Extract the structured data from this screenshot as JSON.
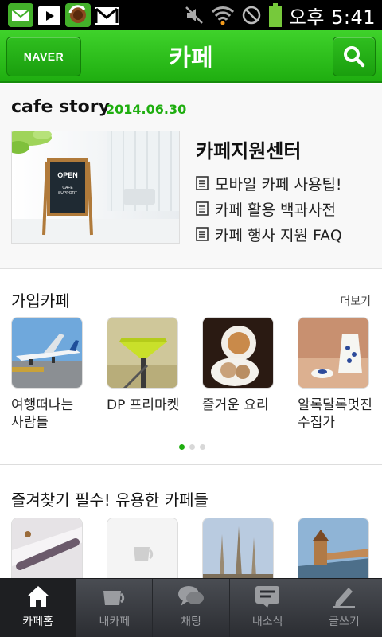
{
  "status_bar": {
    "time": "오후 5:41",
    "icons": [
      "mail-icon",
      "play-store-icon",
      "cafe-app-icon",
      "gmail-icon",
      "mute-icon",
      "wifi-icon",
      "no-signal-icon",
      "battery-icon"
    ]
  },
  "header": {
    "naver_label": "NAVER",
    "title": "카페"
  },
  "story": {
    "title": "cafe story",
    "date": "2014.06.30",
    "sign_line1": "OPEN",
    "sign_line2": "CAFE",
    "sign_line3": "SUPPORT",
    "heading": "카페지원센터",
    "links": [
      "모바일 카페 사용팁!",
      "카페 활용 백과사전",
      "카페 행사 지원 FAQ"
    ]
  },
  "joined": {
    "title": "가입카페",
    "more": "더보기",
    "cafes": [
      {
        "name": "여행떠나는\n사람들"
      },
      {
        "name": "DP 프리마켓"
      },
      {
        "name": "즐거운 요리"
      },
      {
        "name": "알록달록멋진\n수집가"
      }
    ],
    "page_count": 3,
    "active_page": 1
  },
  "useful": {
    "title": "즐겨찾기 필수! 유용한 카페들"
  },
  "tabs": [
    {
      "label": "카페홈",
      "icon": "home-icon",
      "active": true
    },
    {
      "label": "내카페",
      "icon": "cup-icon",
      "active": false
    },
    {
      "label": "채팅",
      "icon": "chat-icon",
      "active": false
    },
    {
      "label": "내소식",
      "icon": "news-icon",
      "active": false
    },
    {
      "label": "글쓰기",
      "icon": "pen-icon",
      "active": false
    }
  ],
  "colors": {
    "brand_green": "#1fae10",
    "status_bar": "#000000",
    "tab_bar": "#2b2d32"
  }
}
